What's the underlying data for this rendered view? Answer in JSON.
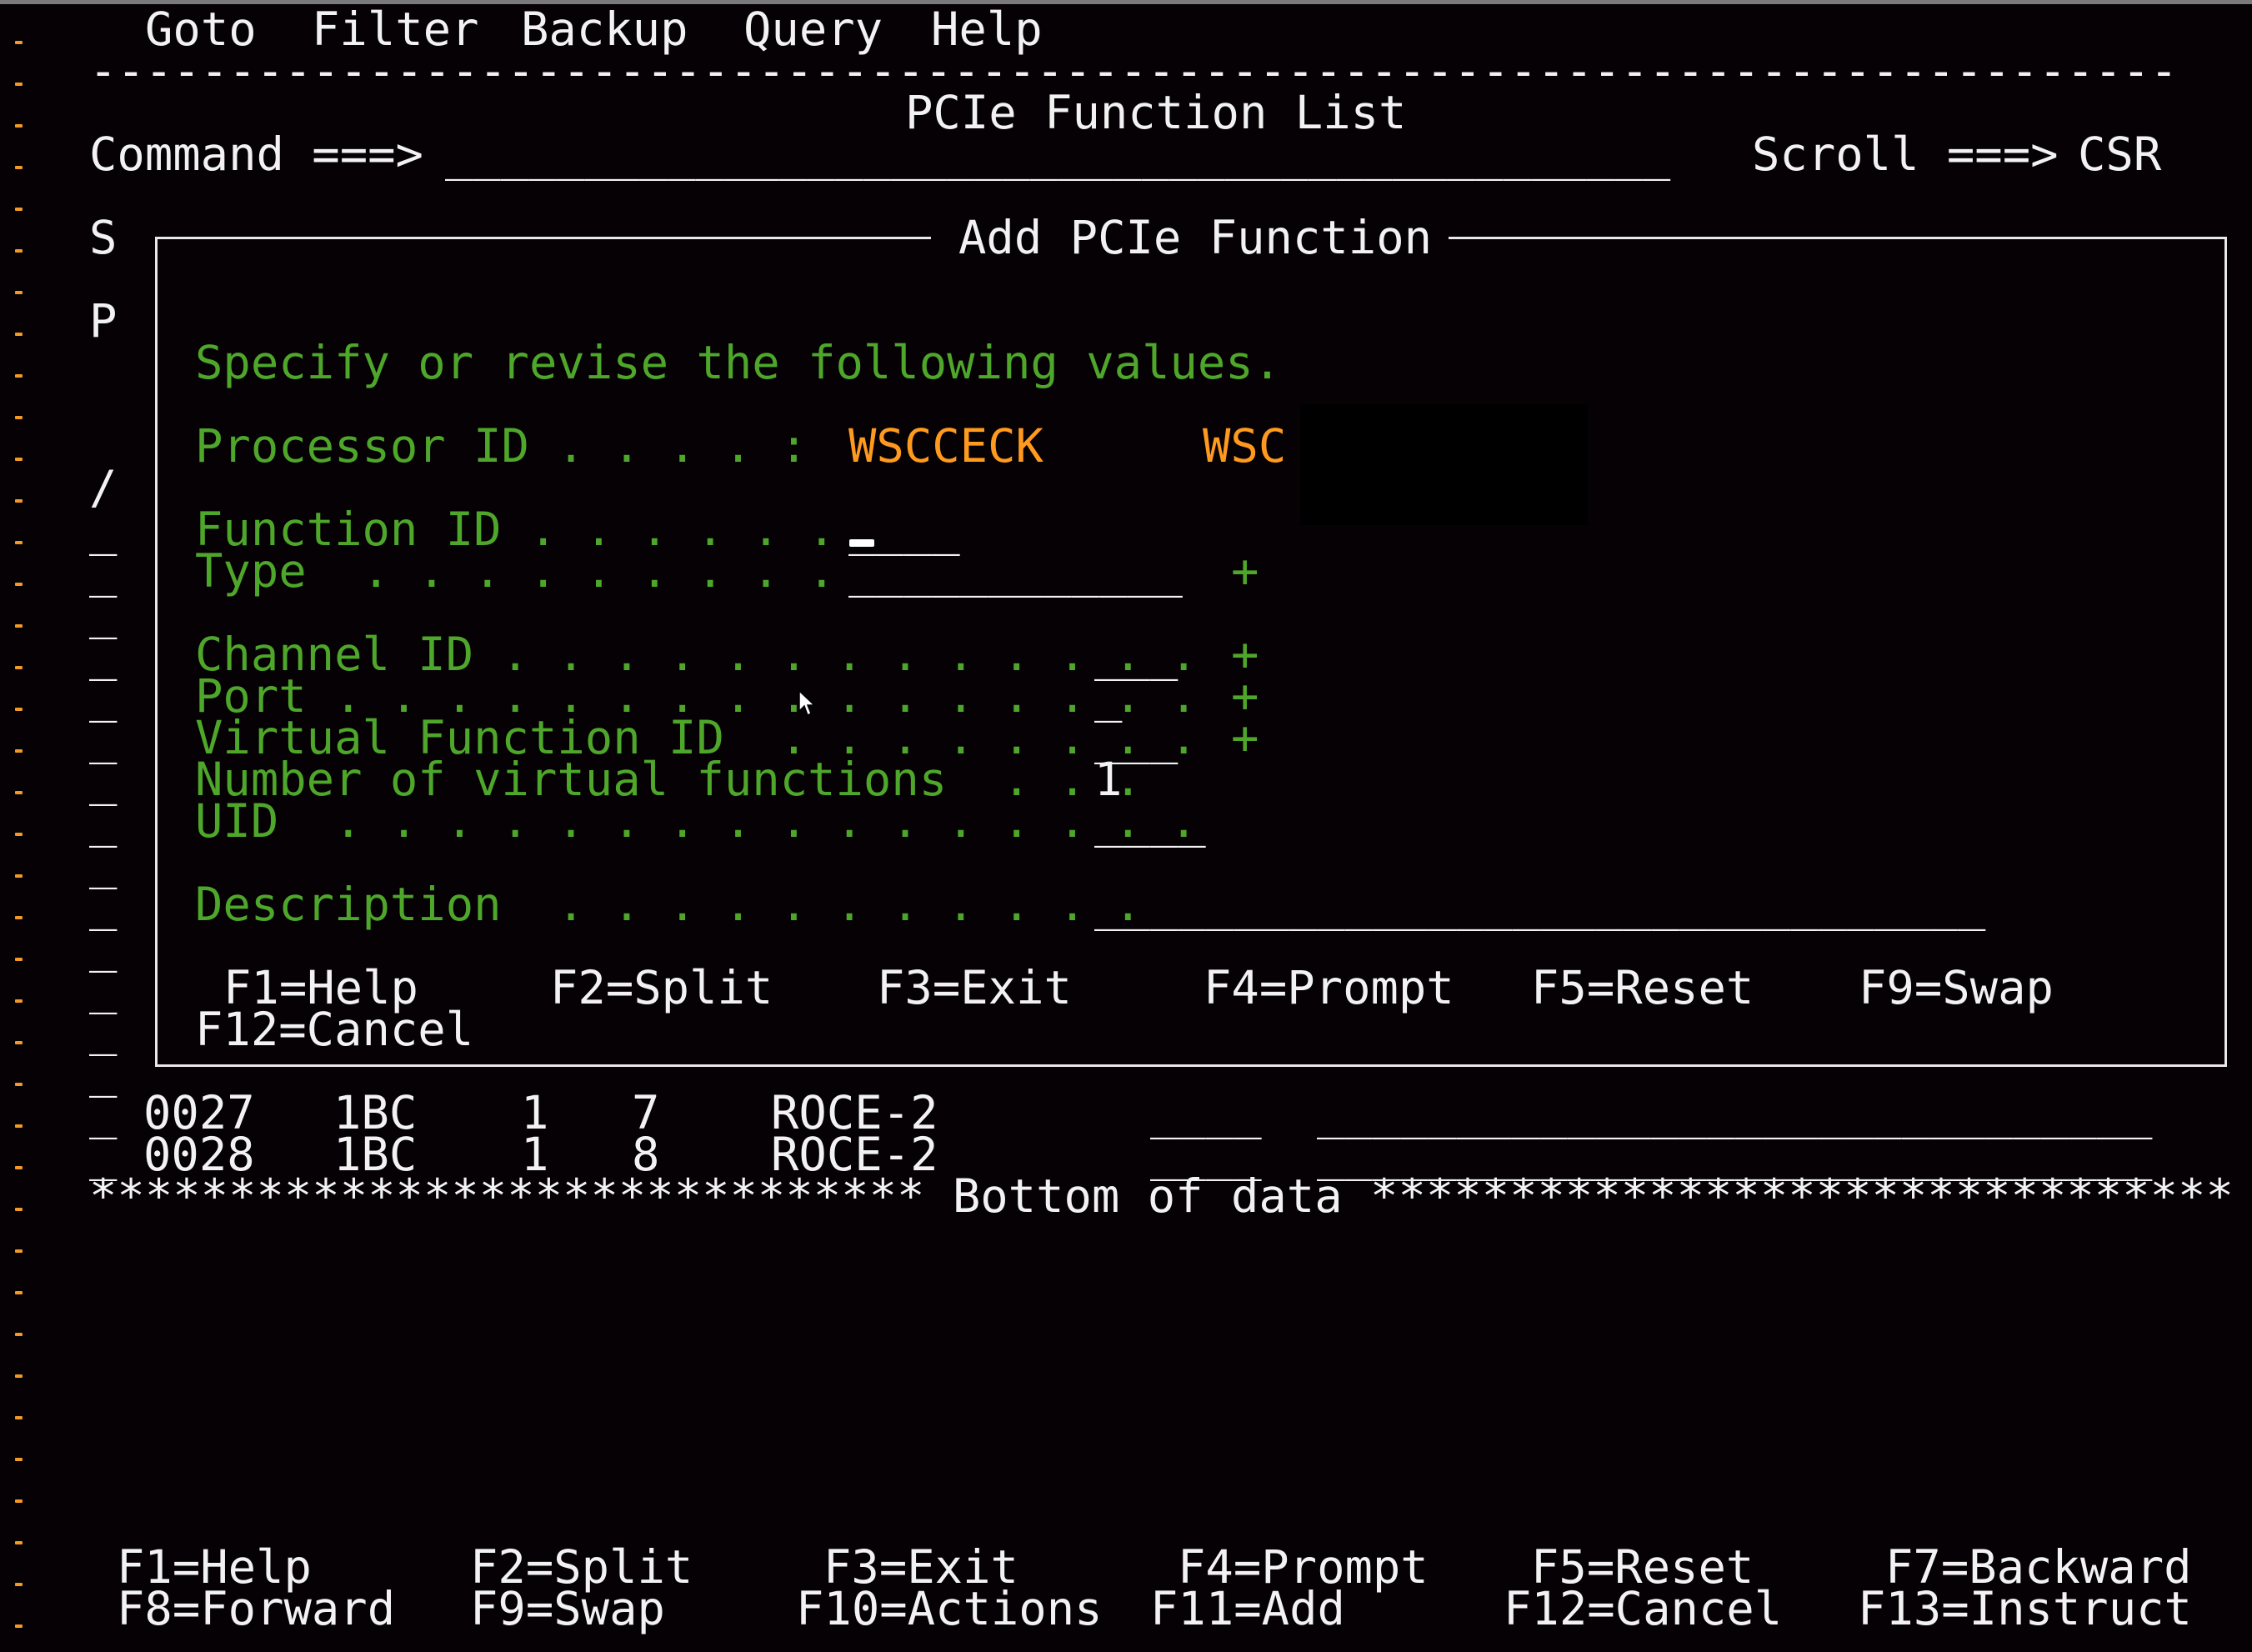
{
  "menu": {
    "items": [
      "Goto",
      "Filter",
      "Backup",
      "Query",
      "Help"
    ]
  },
  "header": {
    "separator": "---------------------------------------------------------------------------",
    "title": "PCIe Function List",
    "command_label": "Command ===>",
    "command_value": "",
    "command_field": "____________________________________________",
    "scroll_label": "Scroll ===>",
    "scroll_value": "CSR"
  },
  "list": {
    "left_col_fragments": [
      "S",
      "P",
      "/"
    ],
    "action_placeholder": "_",
    "rows": [
      {
        "action": "_",
        "function_id": "0027",
        "channel_id": "1BC",
        "port": "1",
        "vf_id": "7",
        "type": "ROCE-2",
        "uid": "____",
        "description": "______________________________"
      },
      {
        "action": "_",
        "function_id": "0028",
        "channel_id": "1BC",
        "port": "1",
        "vf_id": "8",
        "type": "ROCE-2",
        "uid": "____",
        "description": "______________________________"
      }
    ],
    "bottom_marker": "****************************** Bottom of data *******************************"
  },
  "dialog": {
    "title": "Add PCIe Function",
    "instruction": "Specify or revise the following values.",
    "fields": {
      "processor_id": {
        "label": "Processor ID . . . . :",
        "value": "WSCCECK",
        "value2": "WSC"
      },
      "function_id": {
        "label": "Function ID . . . . . .",
        "value": "",
        "field": "____"
      },
      "type": {
        "label": "Type  . . . . . . . . .",
        "value": "",
        "field": "____________",
        "prompt": "+"
      },
      "channel_id": {
        "label": "Channel ID . . . . . . . . . . . . .",
        "value": "",
        "field": "___",
        "prompt": "+"
      },
      "port": {
        "label": "Port . . . . . . . . . . . . . . . .",
        "value": "",
        "field": "_",
        "prompt": "+"
      },
      "virtual_function_id": {
        "label": "Virtual Function ID  . . . . . . . .",
        "value": "",
        "field": "___",
        "prompt": "+"
      },
      "number_of_virtual_functions": {
        "label": "Number of virtual functions  . . .",
        "value": "1"
      },
      "uid": {
        "label": "UID  . . . . . . . . . . . . . . . .",
        "value": "",
        "field": "____"
      },
      "description": {
        "label": "Description  . . . . . . . . . . .",
        "value": "",
        "field": "________________________________"
      }
    },
    "fkeys_row1": [
      "F1=Help",
      "F2=Split",
      "F3=Exit",
      "F4=Prompt",
      "F5=Reset",
      "F9=Swap"
    ],
    "fkeys_row2": [
      "F12=Cancel"
    ]
  },
  "footer": {
    "fkeys_row1": [
      "F1=Help",
      "F2=Split",
      "F3=Exit",
      "F4=Prompt",
      "F5=Reset",
      "F7=Backward"
    ],
    "fkeys_row2": [
      "F8=Forward",
      "F9=Swap",
      "F10=Actions",
      "F11=Add",
      "F12=Cancel",
      "F13=Instruct"
    ]
  },
  "colors": {
    "background": "#050104",
    "text_white": "#f2f2f2",
    "text_green": "#4ea62a",
    "text_orange": "#ff9a1e",
    "margin_marker": "#f39a25"
  }
}
